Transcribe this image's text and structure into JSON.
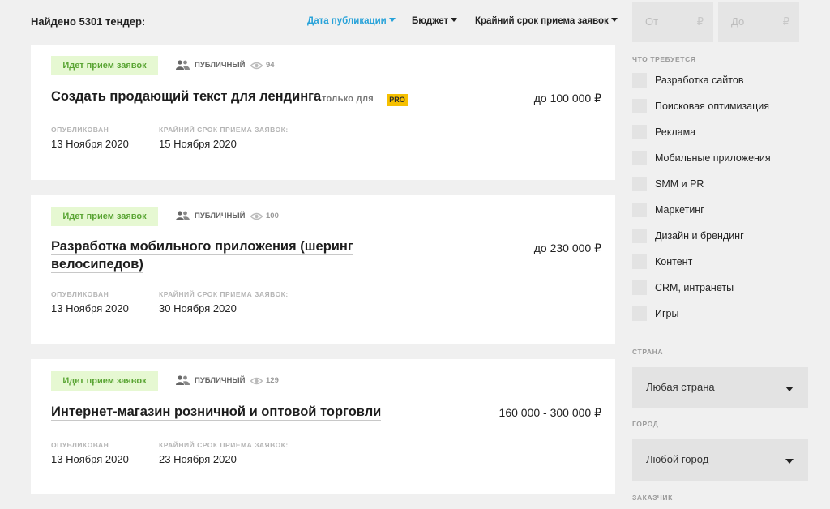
{
  "header": {
    "found": "Найдено 5301 тендер:",
    "sort": {
      "date": "Дата публикации",
      "budget": "Бюджет",
      "deadline": "Крайний срок приема заявок"
    },
    "budget_from": {
      "placeholder": "От",
      "currency": "₽"
    },
    "budget_to": {
      "placeholder": "До",
      "currency": "₽"
    }
  },
  "tenders": [
    {
      "status": "Идет прием заявок",
      "visibility": "ПУБЛИЧНЫЙ",
      "views": "94",
      "title": "Создать продающий текст для лендинга",
      "only_for": "только для",
      "pro_badge": "PRO",
      "price": "до 100 000 ₽",
      "published_label": "ОПУБЛИКОВАН",
      "published": "13 Ноября 2020",
      "deadline_label": "КРАЙНИЙ СРОК ПРИЕМА ЗАЯВОК:",
      "deadline": "15 Ноября 2020"
    },
    {
      "status": "Идет прием заявок",
      "visibility": "ПУБЛИЧНЫЙ",
      "views": "100",
      "title_line1": "Разработка мобильного приложения (шеринг",
      "title_line2": "велосипедов)",
      "price": "до 230 000 ₽",
      "published_label": "ОПУБЛИКОВАН",
      "published": "13 Ноября 2020",
      "deadline_label": "КРАЙНИЙ СРОК ПРИЕМА ЗАЯВОК:",
      "deadline": "30 Ноября 2020"
    },
    {
      "status": "Идет прием заявок",
      "visibility": "ПУБЛИЧНЫЙ",
      "views": "129",
      "title": "Интернет-магазин розничной и оптовой торговли",
      "price": "160 000 - 300 000 ₽",
      "published_label": "ОПУБЛИКОВАН",
      "published": "13 Ноября 2020",
      "deadline_label": "КРАЙНИЙ СРОК ПРИЕМА ЗАЯВОК:",
      "deadline": "23 Ноября 2020"
    }
  ],
  "sidebar": {
    "requirements_title": "ЧТО ТРЕБУЕТСЯ",
    "requirements": [
      "Разработка сайтов",
      "Поисковая оптимизация",
      "Реклама",
      "Мобильные приложения",
      "SMM и PR",
      "Маркетинг",
      "Дизайн и брендинг",
      "Контент",
      "CRM, интранеты",
      "Игры"
    ],
    "country_title": "СТРАНА",
    "country_value": "Любая страна",
    "city_title": "ГОРОД",
    "city_value": "Любой город",
    "customer_title": "ЗАКАЗЧИК"
  },
  "colors": {
    "accent": "#27a2d9",
    "status_bg": "#e6f8d2",
    "status_text": "#5aa534",
    "pro": "#f6c000"
  }
}
